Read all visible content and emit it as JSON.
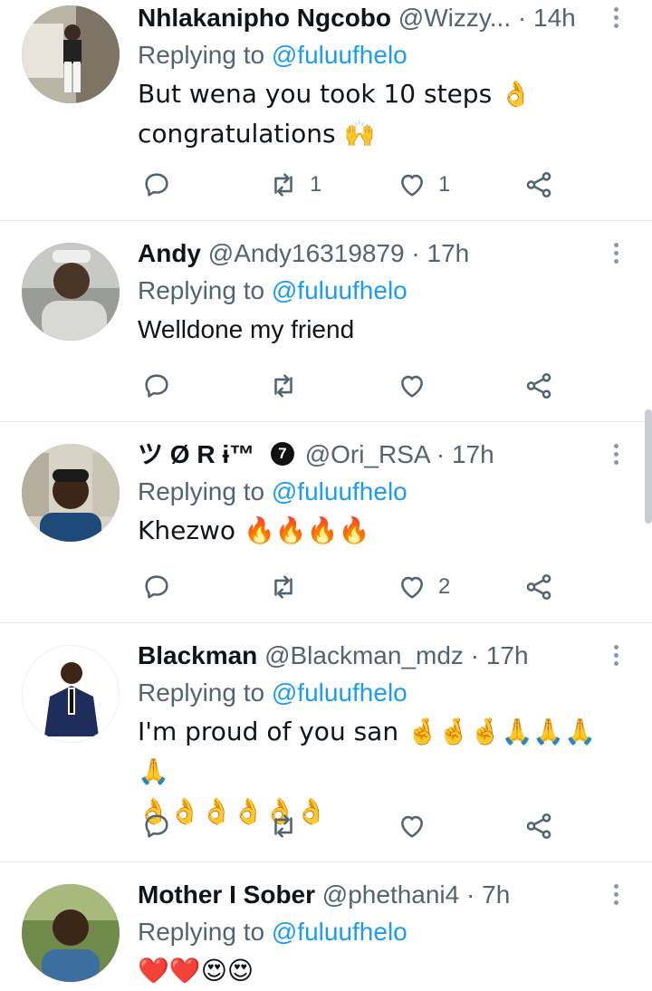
{
  "replies": [
    {
      "name": "Nhlakanipho Ngcobo",
      "handle": "@Wizzy...",
      "time": "14h",
      "replying_prefix": "Replying to",
      "replying_to": "@fuluufhelo",
      "text_lines": [
        "But wena you took 10 steps 👌",
        "congratulations 🙌"
      ],
      "retweets": "1",
      "likes": "1"
    },
    {
      "name": "Andy",
      "handle": "@Andy16319879",
      "time": "17h",
      "replying_prefix": "Replying to",
      "replying_to": "@fuluufhelo",
      "text_lines": [
        "Welldone my friend"
      ],
      "retweets": "",
      "likes": ""
    },
    {
      "name": "ツ Ø R ɨ™",
      "badge": "7",
      "handle": "@Ori_RSA",
      "time": "17h",
      "replying_prefix": "Replying to",
      "replying_to": "@fuluufhelo",
      "text_lines": [
        "Khezwo 🔥🔥🔥🔥"
      ],
      "retweets": "",
      "likes": "2"
    },
    {
      "name": "Blackman",
      "handle": "@Blackman_mdz",
      "time": "17h",
      "replying_prefix": "Replying to",
      "replying_to": "@fuluufhelo",
      "text_lines": [
        "I'm proud of you san 🤞🤞🤞🙏🙏🙏🙏",
        "👌👌👌👌👌👌"
      ],
      "retweets": "",
      "likes": ""
    },
    {
      "name": "Mother I Sober",
      "handle": "@phethani4",
      "time": "7h",
      "replying_prefix": "Replying to",
      "replying_to": "@fuluufhelo",
      "text_lines": [
        "❤️❤️😍😍"
      ],
      "retweets": "",
      "likes": ""
    }
  ],
  "separator": "·",
  "icons": [
    "reply-icon",
    "retweet-icon",
    "like-icon",
    "share-icon",
    "more-options-icon"
  ],
  "colors": {
    "accent": "#1d9bf0",
    "secondary_text": "#536471",
    "primary_text": "#0f1419"
  }
}
